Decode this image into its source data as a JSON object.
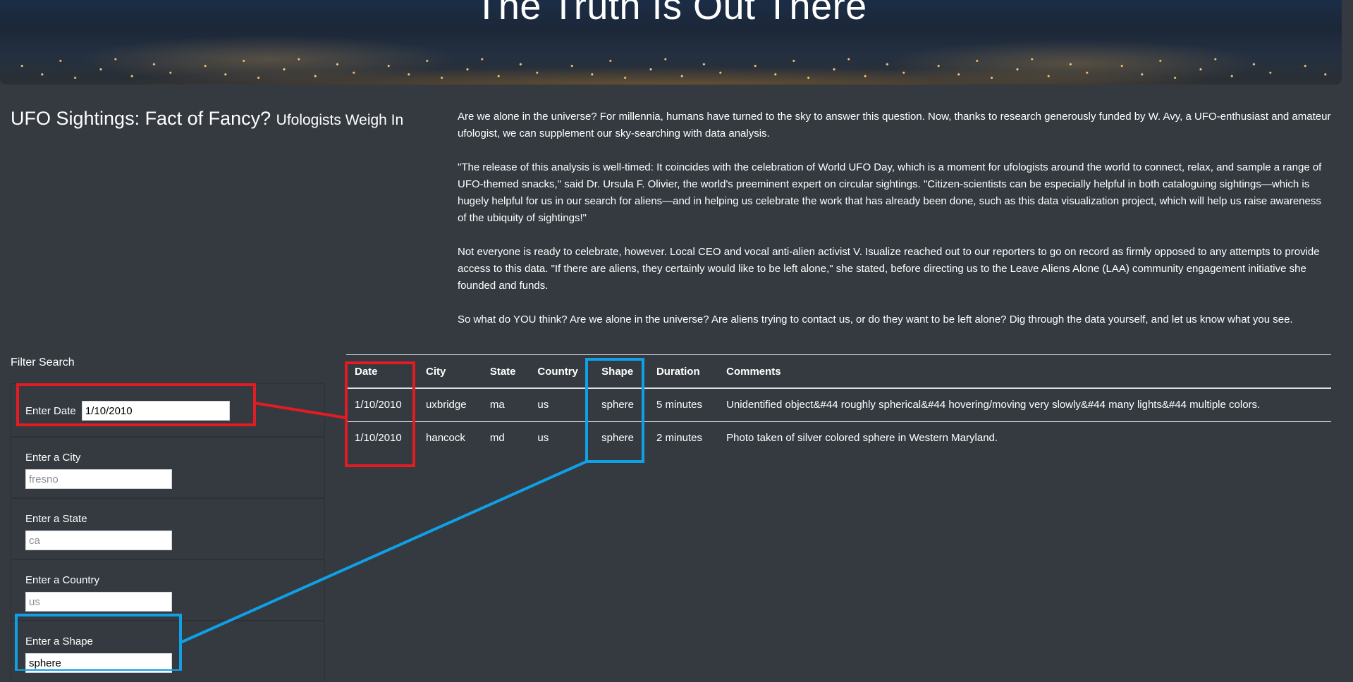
{
  "hero": {
    "title": "The Truth Is Out There"
  },
  "heading": {
    "main": "UFO Sightings: Fact of Fancy?",
    "sub": "Ufologists Weigh In"
  },
  "intro": [
    "Are we alone in the universe? For millennia, humans have turned to the sky to answer this question. Now, thanks to research generously funded by W. Avy, a UFO-enthusiast and amateur ufologist, we can supplement our sky-searching with data analysis.",
    "\"The release of this analysis is well-timed: It coincides with the celebration of World UFO Day, which is a moment for ufologists around the world to connect, relax, and sample a range of UFO-themed snacks,\" said Dr. Ursula F. Olivier, the world's preeminent expert on circular sightings. \"Citizen-scientists can be especially helpful in both cataloguing sightings—which is hugely helpful for us in our search for aliens—and in helping us celebrate the work that has already been done, such as this data visualization project, which will help us raise awareness of the ubiquity of sightings!\"",
    "Not everyone is ready to celebrate, however. Local CEO and vocal anti-alien activist V. Isualize reached out to our reporters to go on record as firmly opposed to any attempts to provide access to this data. \"If there are aliens, they certainly would like to be left alone,\" she stated, before directing us to the Leave Aliens Alone (LAA) community engagement initiative she founded and funds.",
    "So what do YOU think? Are we alone in the universe? Are aliens trying to contact us, or do they want to be left alone? Dig through the data yourself, and let us know what you see."
  ],
  "filters": {
    "title": "Filter Search",
    "date": {
      "label": "Enter Date",
      "value": "1/10/2010",
      "placeholder": ""
    },
    "city": {
      "label": "Enter a City",
      "value": "",
      "placeholder": "fresno"
    },
    "state": {
      "label": "Enter a State",
      "value": "",
      "placeholder": "ca"
    },
    "country": {
      "label": "Enter a Country",
      "value": "",
      "placeholder": "us"
    },
    "shape": {
      "label": "Enter a Shape",
      "value": "sphere",
      "placeholder": ""
    }
  },
  "table": {
    "headers": [
      "Date",
      "City",
      "State",
      "Country",
      "Shape",
      "Duration",
      "Comments"
    ],
    "rows": [
      [
        "1/10/2010",
        "uxbridge",
        "ma",
        "us",
        "sphere",
        "5 minutes",
        "Unidentified object&#44 roughly spherical&#44 hovering/moving very slowly&#44 many lights&#44 multiple colors."
      ],
      [
        "1/10/2010",
        "hancock",
        "md",
        "us",
        "sphere",
        "2 minutes",
        "Photo taken of silver colored sphere in Western Maryland."
      ]
    ]
  },
  "annotations": {
    "date_color": "#e31b23",
    "shape_color": "#0fa0e6"
  }
}
